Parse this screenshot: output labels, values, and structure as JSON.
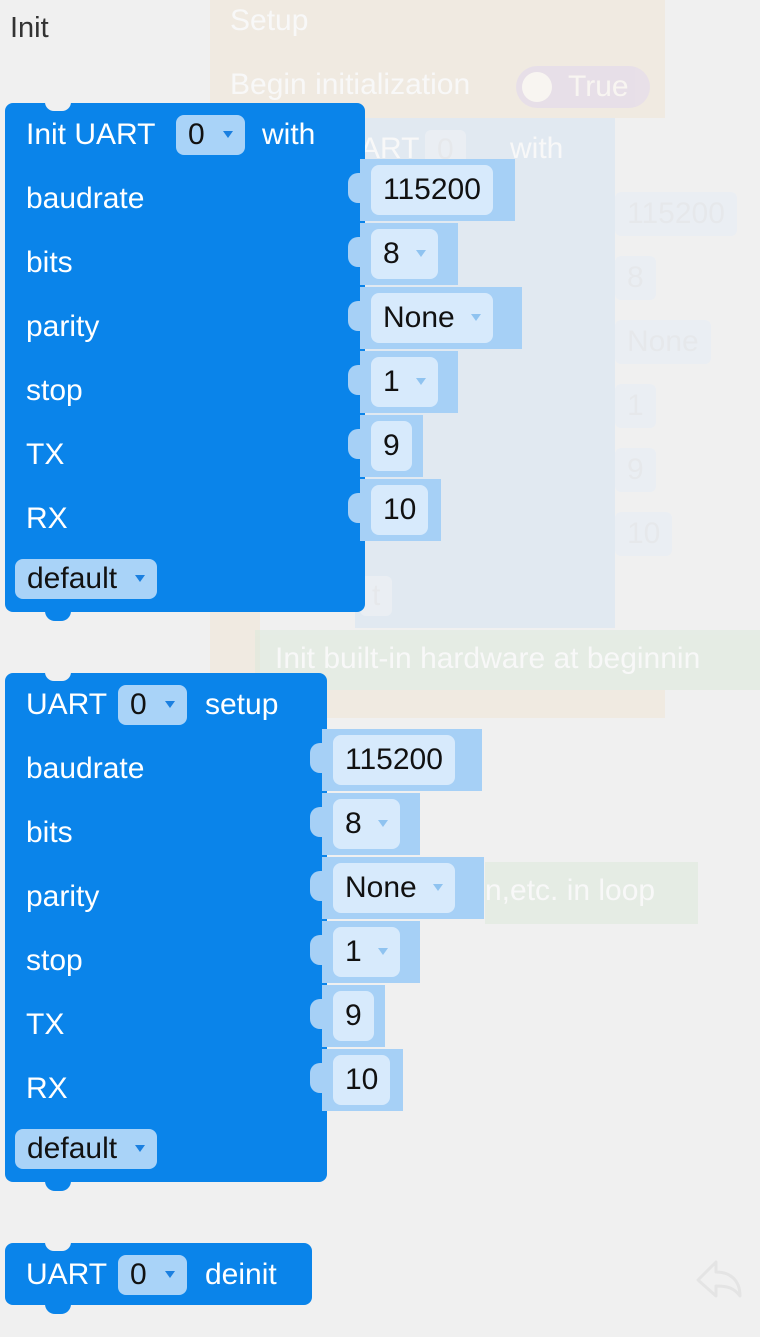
{
  "flyout": {
    "title": "Init"
  },
  "background": {
    "setup_label": "Setup",
    "begin_label": "Begin initialization",
    "toggle_label": "True",
    "uart_partial": "ART",
    "uart_value": "0",
    "with_label": "with",
    "default_partial": "t",
    "init_hw_label": "Init built-in hardware at beginnin",
    "loop_label": "n,etc. in loop",
    "values": [
      "115200",
      "8",
      "None",
      "1",
      "9",
      "10"
    ]
  },
  "blocks": [
    {
      "header": {
        "prefix": "Init UART",
        "port": "0",
        "suffix": "with"
      },
      "rows": [
        {
          "label": "baudrate",
          "value": "115200",
          "dropdown": false
        },
        {
          "label": "bits",
          "value": "8",
          "dropdown": true
        },
        {
          "label": "parity",
          "value": "None",
          "dropdown": true
        },
        {
          "label": "stop",
          "value": "1",
          "dropdown": true
        },
        {
          "label": "TX",
          "value": "9",
          "dropdown": false
        },
        {
          "label": "RX",
          "value": "10",
          "dropdown": false
        }
      ],
      "footer": "default"
    },
    {
      "header": {
        "prefix": "UART",
        "port": "0",
        "suffix": "setup"
      },
      "rows": [
        {
          "label": "baudrate",
          "value": "115200",
          "dropdown": false
        },
        {
          "label": "bits",
          "value": "8",
          "dropdown": true
        },
        {
          "label": "parity",
          "value": "None",
          "dropdown": true
        },
        {
          "label": "stop",
          "value": "1",
          "dropdown": true
        },
        {
          "label": "TX",
          "value": "9",
          "dropdown": false
        },
        {
          "label": "RX",
          "value": "10",
          "dropdown": false
        }
      ],
      "footer": "default"
    },
    {
      "header": {
        "prefix": "UART",
        "port": "0",
        "suffix": "deinit"
      }
    }
  ],
  "colors": {
    "block": "#0a84ea",
    "shadow_block": "#a6d0f6",
    "field": "#d7eafc",
    "dropdown": "#a9d3f8"
  },
  "icons": {
    "undo": "undo-icon"
  }
}
